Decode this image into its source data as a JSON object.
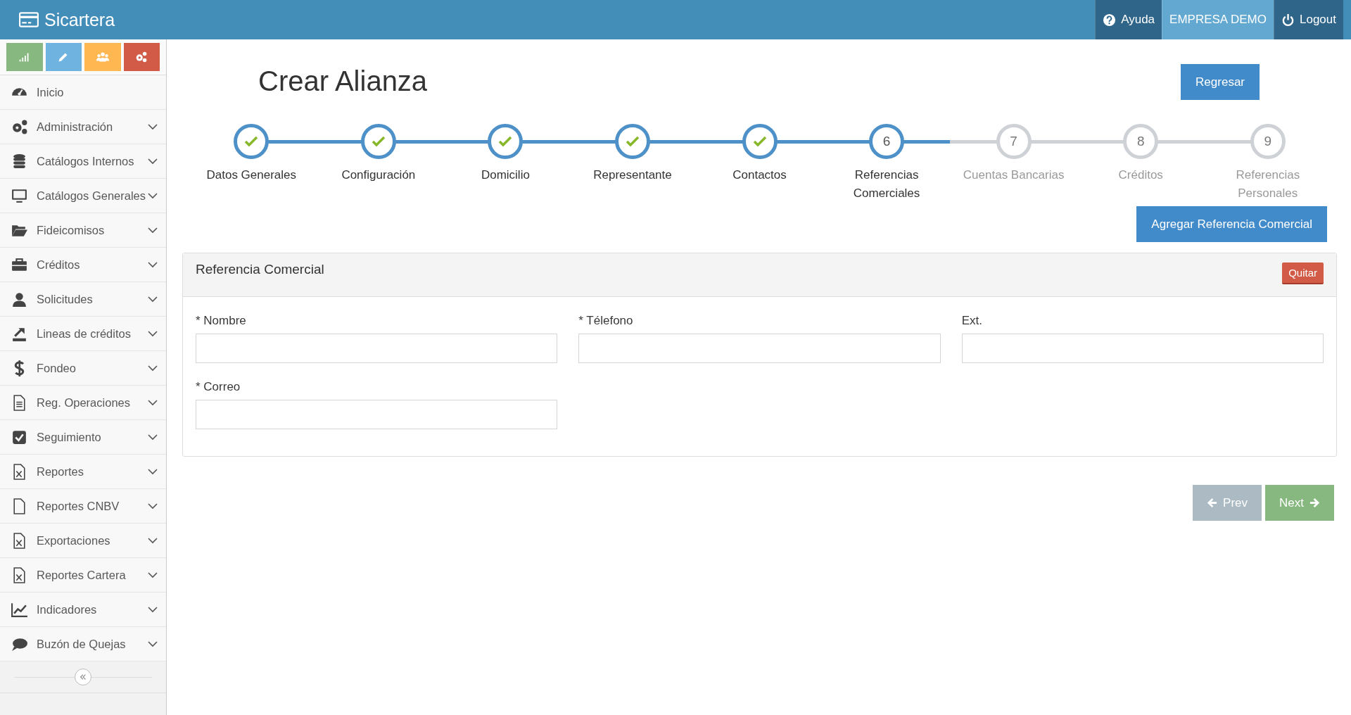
{
  "brand": "Sicartera",
  "top_nav": [
    {
      "kind": "help",
      "label": "Ayuda"
    },
    {
      "kind": "company",
      "label": "EMPRESA DEMO"
    },
    {
      "kind": "logout",
      "label": "Logout"
    }
  ],
  "shortcuts": [
    {
      "color": "#87b87f"
    },
    {
      "color": "#6fb3e0"
    },
    {
      "color": "#ffb752"
    },
    {
      "color": "#d15b47"
    }
  ],
  "sidebar": {
    "items": [
      {
        "label": "Inicio",
        "expandable": false
      },
      {
        "label": "Administración",
        "expandable": true
      },
      {
        "label": "Catálogos Internos",
        "expandable": true
      },
      {
        "label": "Catálogos Generales",
        "expandable": true
      },
      {
        "label": "Fideicomisos",
        "expandable": true
      },
      {
        "label": "Créditos",
        "expandable": true
      },
      {
        "label": "Solicitudes",
        "expandable": true
      },
      {
        "label": "Lineas de créditos",
        "expandable": true
      },
      {
        "label": "Fondeo",
        "expandable": true
      },
      {
        "label": "Reg. Operaciones",
        "expandable": true
      },
      {
        "label": "Seguimiento",
        "expandable": true
      },
      {
        "label": "Reportes",
        "expandable": true
      },
      {
        "label": "Reportes CNBV",
        "expandable": true
      },
      {
        "label": "Exportaciones",
        "expandable": true
      },
      {
        "label": "Reportes Cartera",
        "expandable": true
      },
      {
        "label": "Indicadores",
        "expandable": true
      },
      {
        "label": "Buzón de Quejas",
        "expandable": true
      }
    ]
  },
  "page_title": "Crear Alianza",
  "back_button": "Regresar",
  "steps": [
    {
      "kind": "done",
      "label": "Datos Generales"
    },
    {
      "kind": "done",
      "label": "Configuración"
    },
    {
      "kind": "done",
      "label": "Domicilio"
    },
    {
      "kind": "done",
      "label": "Representante"
    },
    {
      "kind": "done",
      "label": "Contactos"
    },
    {
      "kind": "current",
      "number": "6",
      "label": "Referencias Comerciales"
    },
    {
      "kind": "pending",
      "number": "7",
      "label": "Cuentas Bancarias"
    },
    {
      "kind": "pending",
      "number": "8",
      "label": "Créditos"
    },
    {
      "kind": "pending",
      "number": "9",
      "label": "Referencias Personales"
    }
  ],
  "add_button": "Agregar Referencia Comercial",
  "panel": {
    "title": "Referencia Comercial",
    "remove_button": "Quitar",
    "fields": [
      {
        "label": "* Nombre"
      },
      {
        "label": "* Télefono"
      },
      {
        "label": "Ext."
      },
      {
        "label": "* Correo"
      }
    ]
  },
  "prev_button": "Prev",
  "next_button": "Next"
}
